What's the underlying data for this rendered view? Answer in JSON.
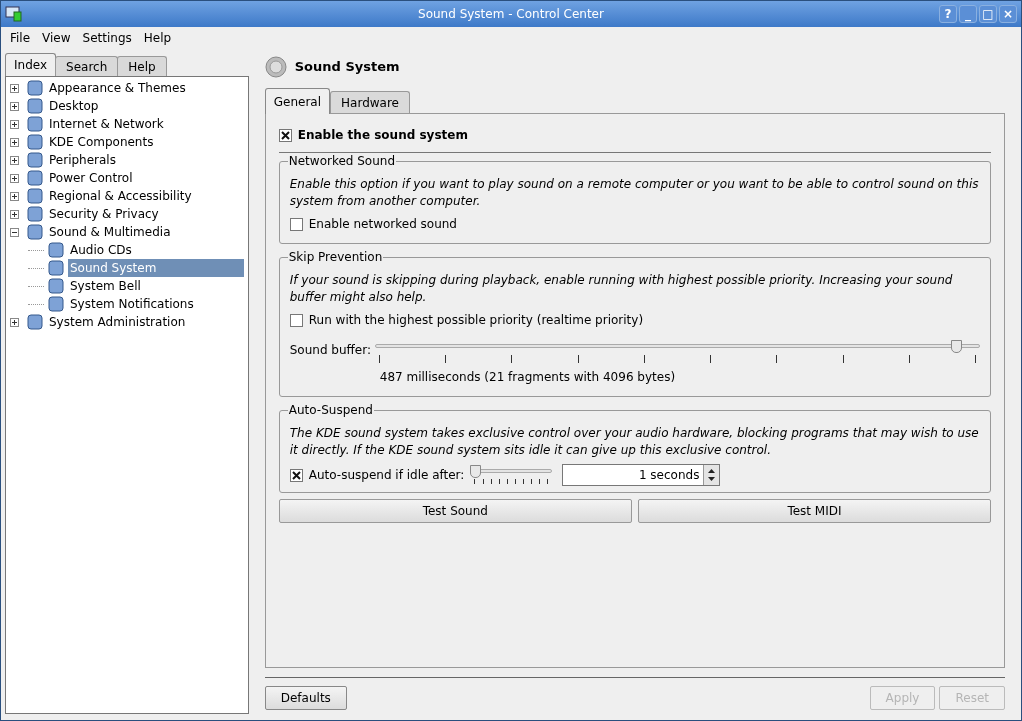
{
  "window": {
    "title": "Sound System - Control Center",
    "controls": [
      "?",
      "_",
      "□",
      "×"
    ]
  },
  "menu": [
    "File",
    "View",
    "Settings",
    "Help"
  ],
  "sidebar": {
    "tabs": [
      {
        "label": "Index",
        "selected": true
      },
      {
        "label": "Search",
        "selected": false
      },
      {
        "label": "Help",
        "selected": false
      }
    ],
    "tree": [
      {
        "label": "Appearance & Themes",
        "expanded": false,
        "selected": false
      },
      {
        "label": "Desktop",
        "expanded": false,
        "selected": false
      },
      {
        "label": "Internet & Network",
        "expanded": false,
        "selected": false
      },
      {
        "label": "KDE Components",
        "expanded": false,
        "selected": false
      },
      {
        "label": "Peripherals",
        "expanded": false,
        "selected": false
      },
      {
        "label": "Power Control",
        "expanded": false,
        "selected": false
      },
      {
        "label": "Regional & Accessibility",
        "expanded": false,
        "selected": false
      },
      {
        "label": "Security & Privacy",
        "expanded": false,
        "selected": false
      },
      {
        "label": "Sound & Multimedia",
        "expanded": true,
        "selected": false,
        "children": [
          {
            "label": "Audio CDs",
            "selected": false
          },
          {
            "label": "Sound System",
            "selected": true
          },
          {
            "label": "System Bell",
            "selected": false
          },
          {
            "label": "System Notifications",
            "selected": false
          }
        ]
      },
      {
        "label": "System Administration",
        "expanded": false,
        "selected": false
      }
    ]
  },
  "page": {
    "title": "Sound System",
    "tabs": [
      {
        "label": "General",
        "selected": true
      },
      {
        "label": "Hardware",
        "selected": false
      }
    ],
    "enable": {
      "label": "Enable the sound system",
      "checked": true
    },
    "groups": [
      {
        "title": "Networked Sound",
        "description": "Enable this option if you want to play sound on a remote computer or you want to be able to control sound on this system from another computer.",
        "checkbox": {
          "label": "Enable networked sound",
          "checked": false
        }
      },
      {
        "title": "Skip Prevention",
        "description": "If your sound is skipping during playback, enable running with highest possible priority. Increasing your sound buffer might also help.",
        "checkbox": {
          "label": "Run with the highest possible priority (realtime priority)",
          "checked": false
        },
        "slider": {
          "label": "Sound buffer:",
          "level": 0.97,
          "reading": "487 milliseconds (21 fragments with 4096 bytes)"
        }
      },
      {
        "title": "Auto-Suspend",
        "description": "The KDE sound system takes exclusive control over your audio hardware, blocking programs that may wish to use it directly. If the KDE sound system sits idle it can give up this exclusive control.",
        "checkbox": {
          "label": "Auto-suspend if idle after:",
          "checked": true
        },
        "mini_slider": {
          "level": 0
        },
        "spinbox": {
          "value": "1 seconds"
        }
      }
    ],
    "buttons": [
      "Test Sound",
      "Test MIDI"
    ]
  },
  "footer": {
    "buttons": [
      {
        "label": "Defaults",
        "disabled": false
      },
      {
        "label": "Apply",
        "disabled": true
      },
      {
        "label": "Reset",
        "disabled": true
      }
    ]
  }
}
